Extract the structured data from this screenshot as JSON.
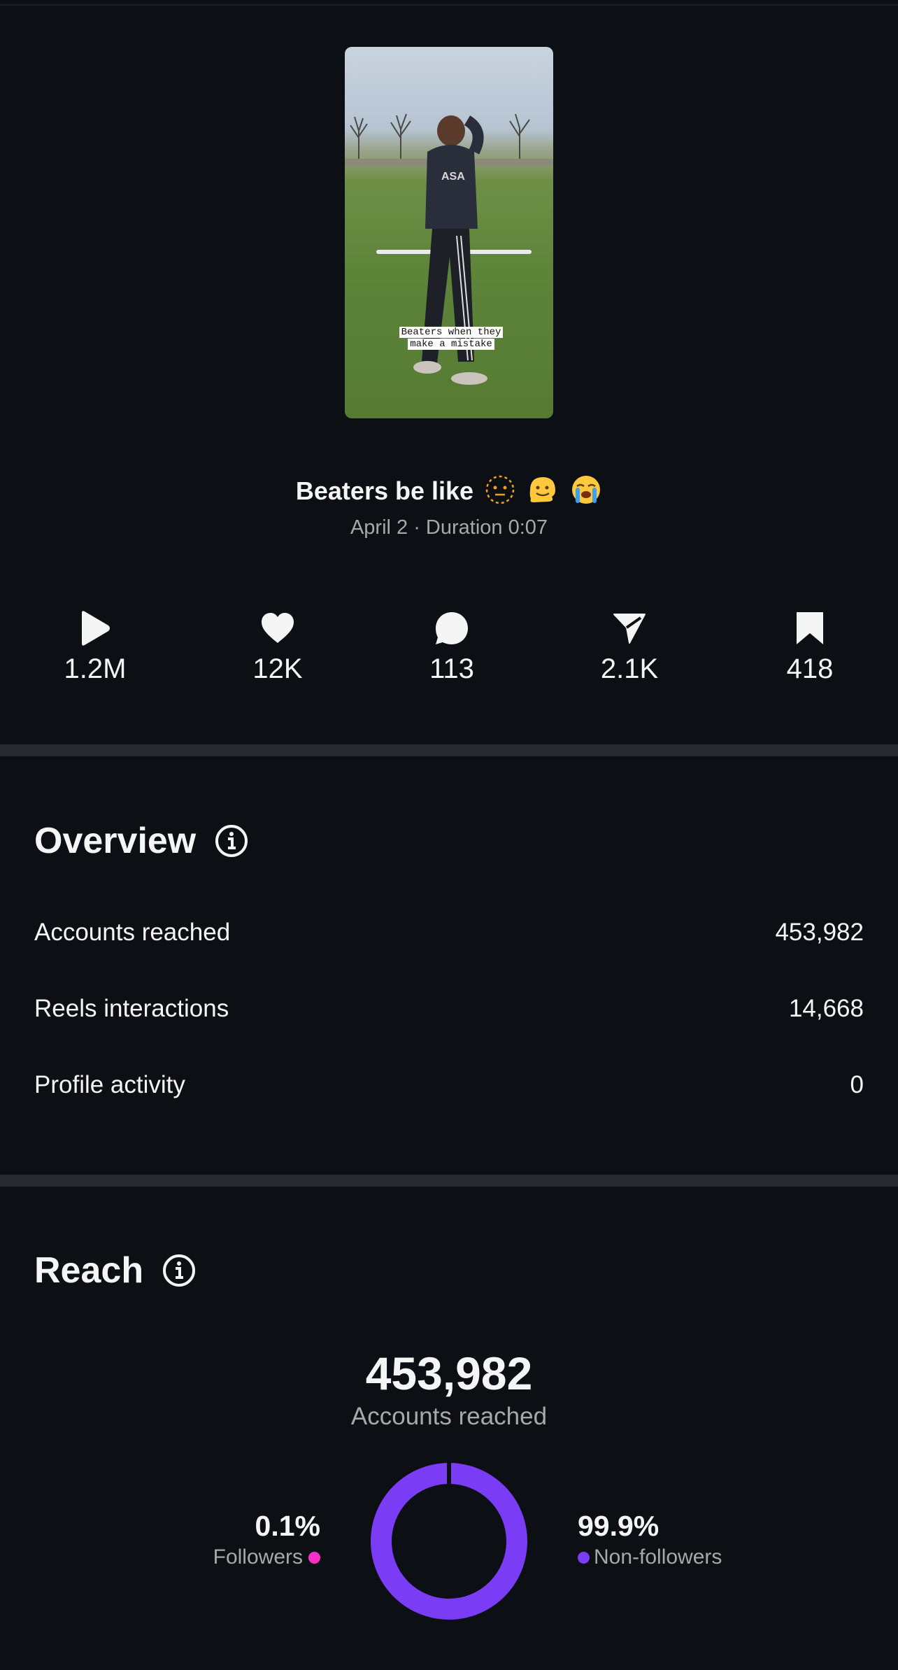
{
  "reel": {
    "title": "Beaters be like",
    "title_emojis": [
      "dotted-face",
      "melting-face",
      "crying-face"
    ],
    "meta": "April 2 · Duration 0:07",
    "thumbnail_caption_line1": "Beaters when they",
    "thumbnail_caption_line2": "make a mistake"
  },
  "stats": [
    {
      "icon": "play-icon",
      "value": "1.2M"
    },
    {
      "icon": "heart-icon",
      "value": "12K"
    },
    {
      "icon": "comment-icon",
      "value": "113"
    },
    {
      "icon": "share-icon",
      "value": "2.1K"
    },
    {
      "icon": "bookmark-icon",
      "value": "418"
    }
  ],
  "overview": {
    "title": "Overview",
    "rows": [
      {
        "label": "Accounts reached",
        "value": "453,982"
      },
      {
        "label": "Reels interactions",
        "value": "14,668"
      },
      {
        "label": "Profile activity",
        "value": "0"
      }
    ]
  },
  "reach": {
    "title": "Reach",
    "total": "453,982",
    "total_label": "Accounts reached",
    "followers_pct": "0.1%",
    "followers_label": "Followers",
    "non_followers_pct": "99.9%",
    "non_followers_label": "Non-followers",
    "followers_fraction": 0.001,
    "colors": {
      "followers": "#ff30c8",
      "non_followers": "#7a3cf5"
    }
  }
}
